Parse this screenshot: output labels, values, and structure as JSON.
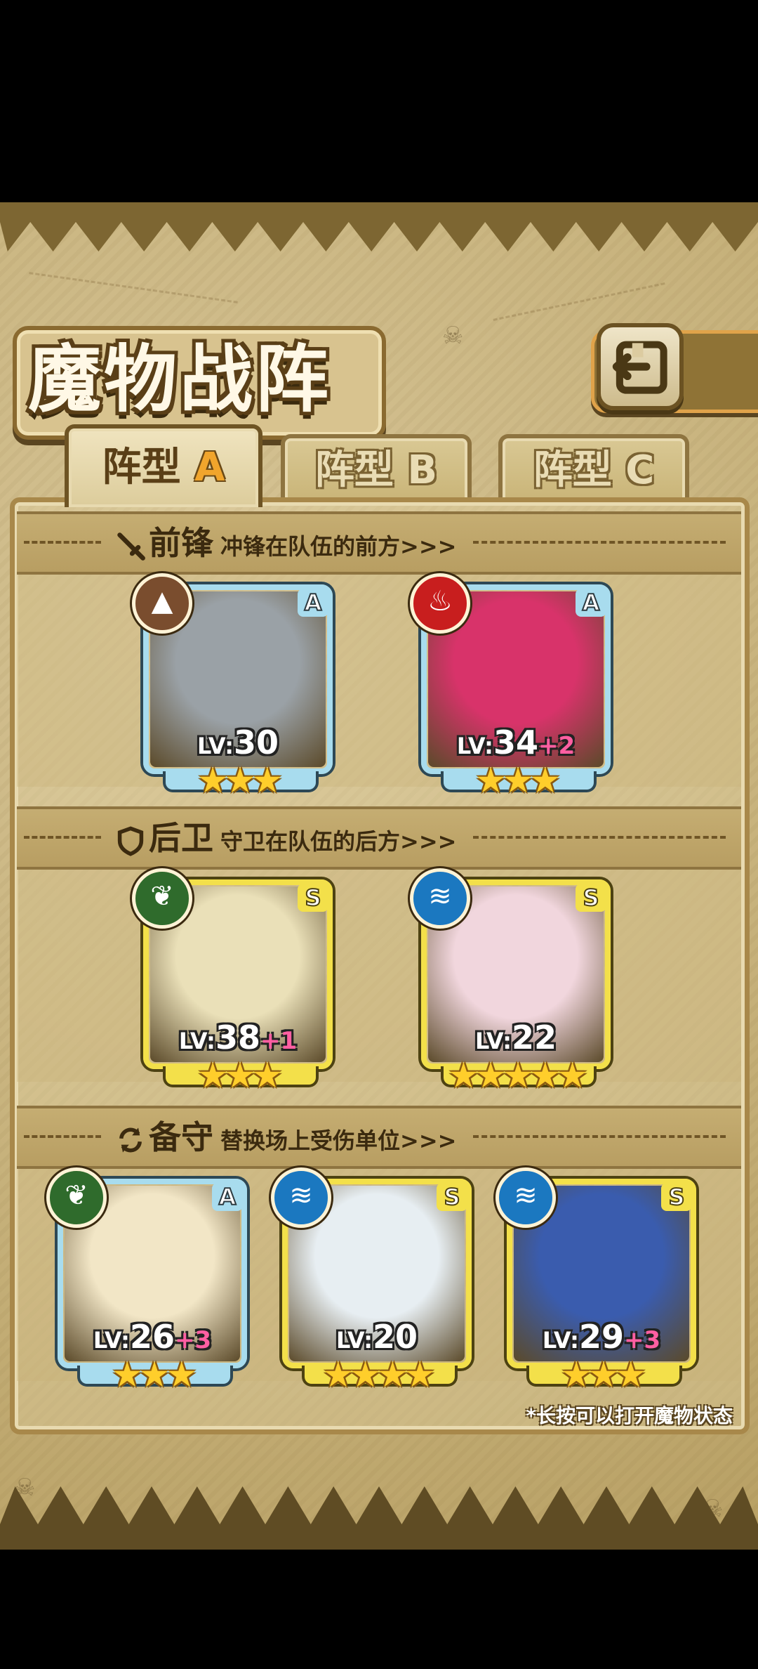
{
  "header": {
    "title": "魔物战阵"
  },
  "tabs": [
    {
      "label": "阵型",
      "letter": "A",
      "active": true
    },
    {
      "label": "阵型",
      "letter": "B",
      "active": false
    },
    {
      "label": "阵型",
      "letter": "C",
      "active": false
    }
  ],
  "sections": {
    "front": {
      "title": "前锋",
      "subtitle": "冲锋在队伍的前方>>>",
      "icon": "sword-icon"
    },
    "back": {
      "title": "后卫",
      "subtitle": "守卫在队伍的后方>>>",
      "icon": "shield-icon"
    },
    "reserve": {
      "title": "备守",
      "subtitle": "替换场上受伤单位>>>",
      "icon": "swap-icon"
    }
  },
  "monsters": {
    "front": [
      {
        "rank": "A",
        "element": "earth",
        "level": "30",
        "bonus": "",
        "stars": "★★★",
        "art_color": "#9aa1a6"
      },
      {
        "rank": "A",
        "element": "fire",
        "level": "34",
        "bonus": "+2",
        "stars": "★★★",
        "art_color": "#d8336a"
      }
    ],
    "back": [
      {
        "rank": "S",
        "element": "plant",
        "level": "38",
        "bonus": "+1",
        "stars": "★★★",
        "art_color": "#eae0b8"
      },
      {
        "rank": "S",
        "element": "water",
        "level": "22",
        "bonus": "",
        "stars": "★★★★★",
        "art_color": "#f1d6dd"
      }
    ],
    "reserve": [
      {
        "rank": "A",
        "element": "plant",
        "level": "26",
        "bonus": "+3",
        "stars": "★★★",
        "art_color": "#f2e6c6"
      },
      {
        "rank": "S",
        "element": "water",
        "level": "20",
        "bonus": "",
        "stars": "★★★★",
        "art_color": "#e7eef2"
      },
      {
        "rank": "S",
        "element": "water",
        "level": "29",
        "bonus": "+3",
        "stars": "★★★",
        "art_color": "#3a5cae"
      }
    ]
  },
  "labels": {
    "lv_prefix": "LV:"
  },
  "footer": {
    "hint": "*长按可以打开魔物状态"
  }
}
